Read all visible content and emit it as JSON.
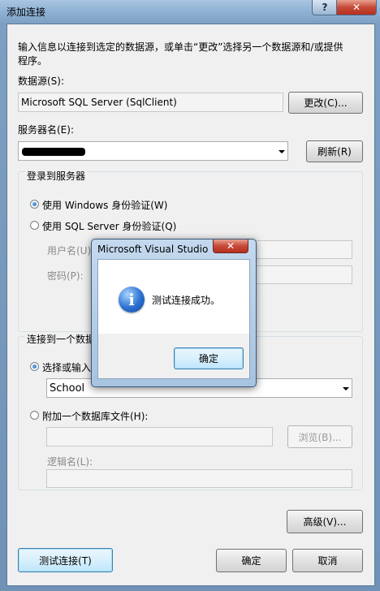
{
  "window": {
    "title": "添加连接",
    "help_label": "?",
    "close_label": "✕"
  },
  "intro": {
    "text_line1": "输入信息以连接到选定的数据源，或单击“更改”选择另一个数据源和/或提供",
    "text_line2": "程序。"
  },
  "datasource": {
    "label": "数据源(S):",
    "value": "Microsoft SQL Server (SqlClient)",
    "change_button": "更改(C)..."
  },
  "server": {
    "label": "服务器名(E):",
    "value": "",
    "refresh_button": "刷新(R)"
  },
  "login_group": {
    "title": "登录到服务器",
    "windows_auth": "使用 Windows 身份验证(W)",
    "sql_auth": "使用 SQL Server 身份验证(Q)",
    "username_label": "用户名(U):",
    "password_label": "密码(P):"
  },
  "db_group": {
    "title": "连接到一个数据",
    "select_db": "选择或输入",
    "db_value": "School",
    "attach_file": "附加一个数据库文件(H):",
    "browse_button": "浏览(B)...",
    "logical_name_label": "逻辑名(L):"
  },
  "footer": {
    "advanced_button": "高级(V)...",
    "test_button": "测试连接(T)",
    "ok_button": "确定",
    "cancel_button": "取消"
  },
  "msgbox": {
    "title": "Microsoft Visual Studio",
    "close_label": "✕",
    "icon_glyph": "i",
    "message": "测试连接成功。",
    "ok_button": "确定"
  }
}
